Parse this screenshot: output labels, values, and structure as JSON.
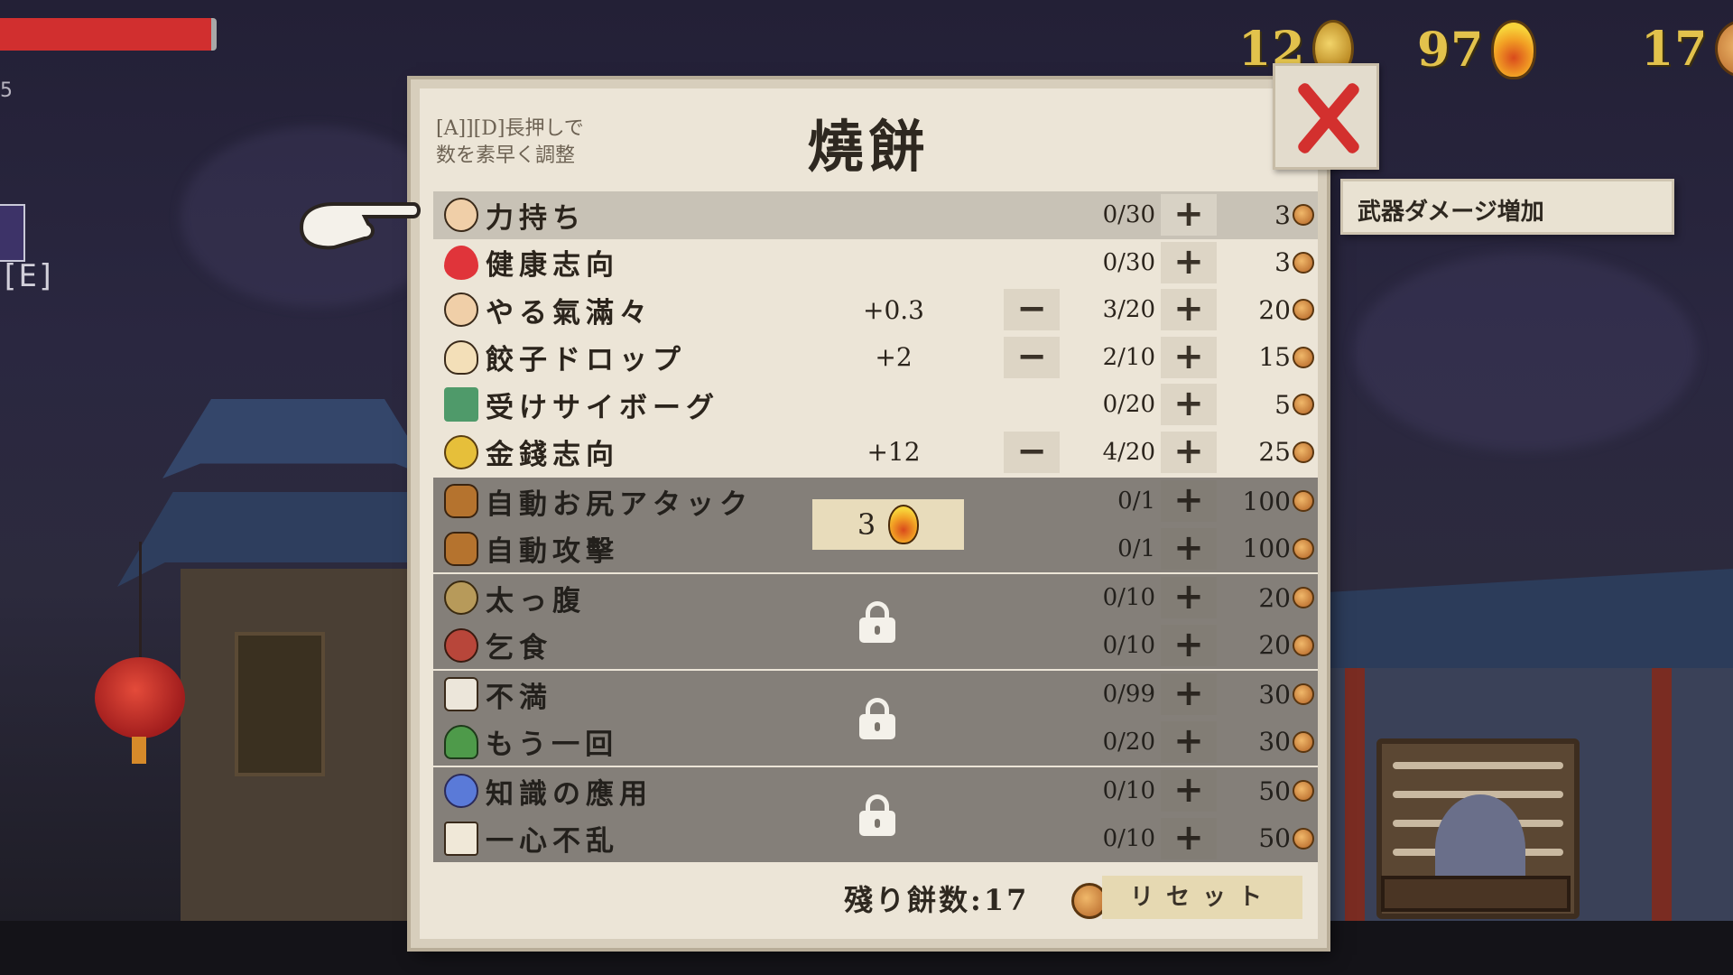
{
  "hud": {
    "side_number": "5",
    "key_label": "[E]",
    "currencies": [
      {
        "value": "12",
        "icon": "gold-coin-icon"
      },
      {
        "value": "97",
        "icon": "flame-gem-icon"
      },
      {
        "value": "17",
        "icon": "mochi-coin-icon"
      }
    ]
  },
  "panel": {
    "hint": "[A]][D]長押しで\n数を素早く調整",
    "title": "燒餅",
    "tooltip": "武器ダメージ増加",
    "remaining_label": "殘り餅数:17",
    "reset_label": "リセット"
  },
  "rows": [
    {
      "name": "力持ち",
      "icon": "fist-icon",
      "bonus": "",
      "count": "0/30",
      "cost": "3",
      "minus": false
    },
    {
      "name": "健康志向",
      "icon": "heart-icon",
      "bonus": "",
      "count": "0/30",
      "cost": "3",
      "minus": false
    },
    {
      "name": "やる氣滿々",
      "icon": "cheer-icon",
      "bonus": "+0.3",
      "count": "3/20",
      "cost": "20",
      "minus": true
    },
    {
      "name": "餃子ドロップ",
      "icon": "dumpling-icon",
      "bonus": "+2",
      "count": "2/10",
      "cost": "15",
      "minus": true
    },
    {
      "name": "受けサイボーグ",
      "icon": "book-icon",
      "bonus": "",
      "count": "0/20",
      "cost": "5",
      "minus": false
    },
    {
      "name": "金錢志向",
      "icon": "coins-icon",
      "bonus": "+12",
      "count": "4/20",
      "cost": "25",
      "minus": true
    }
  ],
  "locked_groups": [
    {
      "unlock_cost": "3",
      "rows": [
        {
          "name": "自動お尻アタック",
          "icon": "thumb-icon",
          "count": "0/1",
          "cost": "100"
        },
        {
          "name": "自動攻擊",
          "icon": "thumb-icon",
          "count": "0/1",
          "cost": "100"
        }
      ]
    },
    {
      "rows": [
        {
          "name": "太っ腹",
          "icon": "belly-icon",
          "count": "0/10",
          "cost": "20"
        },
        {
          "name": "乞食",
          "icon": "beg-icon",
          "count": "0/10",
          "cost": "20"
        }
      ]
    },
    {
      "rows": [
        {
          "name": "不満",
          "icon": "dice-icon",
          "count": "0/99",
          "cost": "30"
        },
        {
          "name": "もう一回",
          "icon": "mushroom-icon",
          "count": "0/20",
          "cost": "30"
        }
      ]
    },
    {
      "rows": [
        {
          "name": "知識の應用",
          "icon": "dna-icon",
          "count": "0/10",
          "cost": "50"
        },
        {
          "name": "一心不乱",
          "icon": "open-book-icon",
          "count": "0/10",
          "cost": "50"
        }
      ]
    }
  ]
}
